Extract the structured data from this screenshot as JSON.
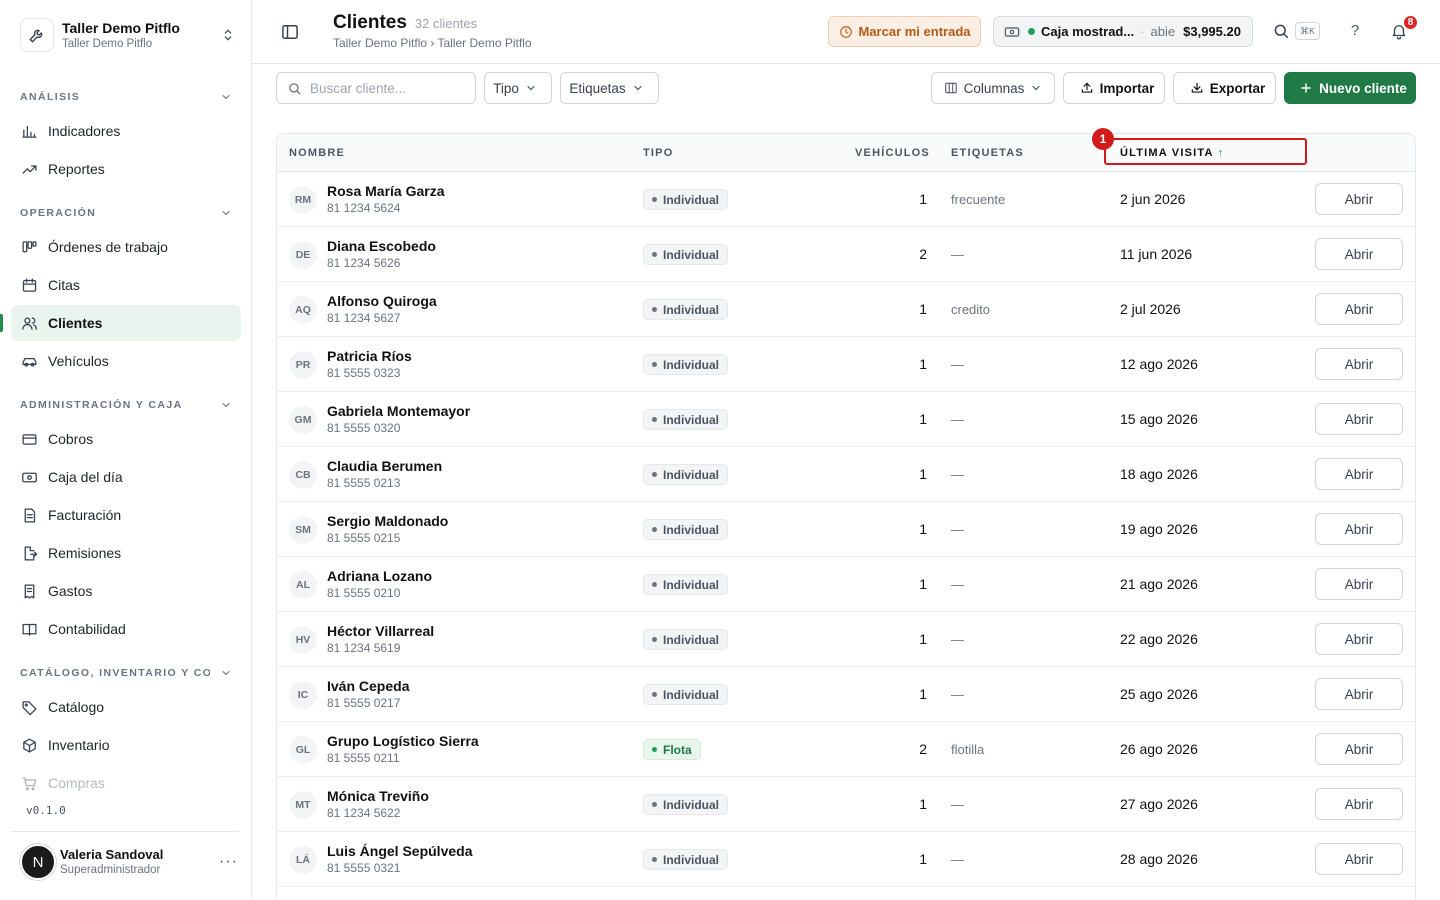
{
  "org": {
    "name": "Taller Demo Pitflo",
    "sub": "Taller Demo Pitflo"
  },
  "sidebar": {
    "sections": [
      {
        "label": "ANÁLISIS",
        "items": [
          {
            "label": "Indicadores",
            "icon": "bar-chart-icon"
          },
          {
            "label": "Reportes",
            "icon": "trend-icon"
          }
        ]
      },
      {
        "label": "OPERACIÓN",
        "items": [
          {
            "label": "Órdenes de trabajo",
            "icon": "kanban-icon"
          },
          {
            "label": "Citas",
            "icon": "calendar-icon"
          },
          {
            "label": "Clientes",
            "icon": "users-icon",
            "active": true
          },
          {
            "label": "Vehículos",
            "icon": "car-icon"
          }
        ]
      },
      {
        "label": "ADMINISTRACIÓN Y CAJA",
        "items": [
          {
            "label": "Cobros",
            "icon": "card-icon"
          },
          {
            "label": "Caja del día",
            "icon": "cash-icon"
          },
          {
            "label": "Facturación",
            "icon": "invoice-icon"
          },
          {
            "label": "Remisiones",
            "icon": "file-export-icon"
          },
          {
            "label": "Gastos",
            "icon": "receipt-icon"
          },
          {
            "label": "Contabilidad",
            "icon": "book-icon"
          }
        ]
      },
      {
        "label": "CATÁLOGO, INVENTARIO Y CO...",
        "items": [
          {
            "label": "Catálogo",
            "icon": "tag-icon"
          },
          {
            "label": "Inventario",
            "icon": "box-icon"
          },
          {
            "label": "Compras",
            "icon": "cart-icon"
          }
        ]
      }
    ],
    "version": "v0.1.0",
    "user": {
      "initial": "N",
      "name": "Valeria Sandoval",
      "role": "Superadministrador",
      "more": "···"
    }
  },
  "header": {
    "title": "Clientes",
    "count": "32 clientes",
    "breadcrumb": "Taller Demo Pitflo › Taller Demo Pitflo",
    "clockin_label": "Marcar mi entrada",
    "cashbox": {
      "name": "Caja mostrad...",
      "sep": "·",
      "status": "abie",
      "amount": "$3,995.20"
    },
    "search_shortcut": "⌘K",
    "help": "?",
    "notifications": "8"
  },
  "toolbar": {
    "search_placeholder": "Buscar cliente...",
    "type_label": "Tipo",
    "tags_label": "Etiquetas",
    "columns_label": "Columnas",
    "import_label": "Importar",
    "export_label": "Exportar",
    "new_label": "Nuevo cliente"
  },
  "table": {
    "columns": {
      "name": "NOMBRE",
      "type": "TIPO",
      "vehicles": "VEHÍCULOS",
      "tags": "ETIQUETAS",
      "last_visit": "ÚLTIMA VISITA"
    },
    "sort_arrow": "↑",
    "marker": "1",
    "open_label": "Abrir",
    "rows": [
      {
        "initials": "RM",
        "name": "Rosa María Garza",
        "phone": "81 1234 5624",
        "type": "Individual",
        "vehicles": "1",
        "tags": "frecuente",
        "last_visit": "2 jun 2026"
      },
      {
        "initials": "DE",
        "name": "Diana Escobedo",
        "phone": "81 1234 5626",
        "type": "Individual",
        "vehicles": "2",
        "tags": "—",
        "last_visit": "11 jun 2026"
      },
      {
        "initials": "AQ",
        "name": "Alfonso Quiroga",
        "phone": "81 1234 5627",
        "type": "Individual",
        "vehicles": "1",
        "tags": "credito",
        "last_visit": "2 jul 2026"
      },
      {
        "initials": "PR",
        "name": "Patricia Ríos",
        "phone": "81 5555 0323",
        "type": "Individual",
        "vehicles": "1",
        "tags": "—",
        "last_visit": "12 ago 2026"
      },
      {
        "initials": "GM",
        "name": "Gabriela Montemayor",
        "phone": "81 5555 0320",
        "type": "Individual",
        "vehicles": "1",
        "tags": "—",
        "last_visit": "15 ago 2026"
      },
      {
        "initials": "CB",
        "name": "Claudia Berumen",
        "phone": "81 5555 0213",
        "type": "Individual",
        "vehicles": "1",
        "tags": "—",
        "last_visit": "18 ago 2026"
      },
      {
        "initials": "SM",
        "name": "Sergio Maldonado",
        "phone": "81 5555 0215",
        "type": "Individual",
        "vehicles": "1",
        "tags": "—",
        "last_visit": "19 ago 2026"
      },
      {
        "initials": "AL",
        "name": "Adriana Lozano",
        "phone": "81 5555 0210",
        "type": "Individual",
        "vehicles": "1",
        "tags": "—",
        "last_visit": "21 ago 2026"
      },
      {
        "initials": "HV",
        "name": "Héctor Villarreal",
        "phone": "81 1234 5619",
        "type": "Individual",
        "vehicles": "1",
        "tags": "—",
        "last_visit": "22 ago 2026"
      },
      {
        "initials": "IC",
        "name": "Iván Cepeda",
        "phone": "81 5555 0217",
        "type": "Individual",
        "vehicles": "1",
        "tags": "—",
        "last_visit": "25 ago 2026"
      },
      {
        "initials": "GL",
        "name": "Grupo Logístico Sierra",
        "phone": "81 5555 0211",
        "type": "Flota",
        "vehicles": "2",
        "tags": "flotilla",
        "last_visit": "26 ago 2026"
      },
      {
        "initials": "MT",
        "name": "Mónica Treviño",
        "phone": "81 1234 5622",
        "type": "Individual",
        "vehicles": "1",
        "tags": "—",
        "last_visit": "27 ago 2026"
      },
      {
        "initials": "LÁ",
        "name": "Luis Ángel Sepúlveda",
        "phone": "81 5555 0321",
        "type": "Individual",
        "vehicles": "1",
        "tags": "—",
        "last_visit": "28 ago 2026"
      }
    ]
  },
  "colors": {
    "accent": "#1f7a45",
    "highlight": "#d11a1a",
    "active_bg": "#eaf4ee"
  }
}
